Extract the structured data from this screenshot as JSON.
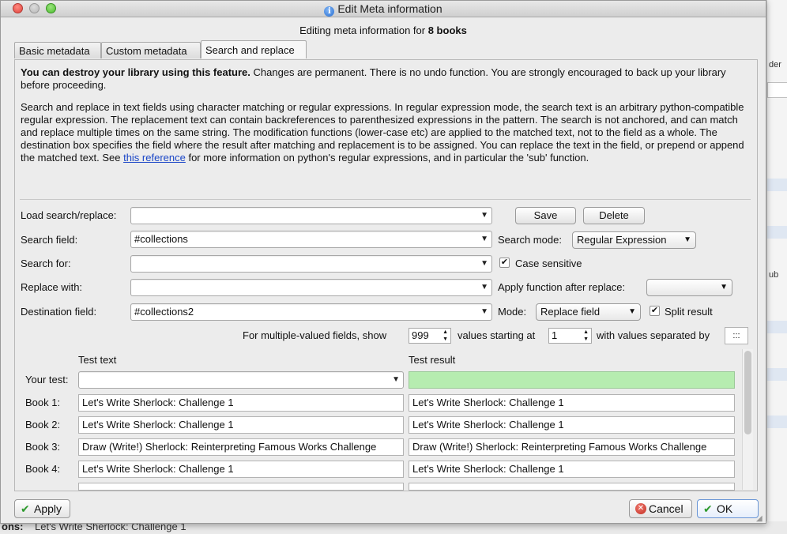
{
  "window": {
    "title": "Edit Meta information"
  },
  "heading": {
    "prefix": "Editing meta information for ",
    "count": "8 books"
  },
  "tabs": [
    {
      "label": "Basic metadata"
    },
    {
      "label": "Custom metadata"
    },
    {
      "label": "Search and replace"
    }
  ],
  "warning": {
    "bold": "You can destroy your library using this feature.",
    "rest": " Changes are permanent. There is no undo function. You are strongly encouraged to back up your library before proceeding."
  },
  "description": {
    "text": "Search and replace in text fields using character matching or regular expressions. In regular expression mode, the search text is an arbitrary python-compatible regular expression. The replacement text can contain backreferences to parenthesized expressions in the pattern. The search is not anchored, and can match and replace multiple times on the same string. The modification functions (lower-case etc) are applied to the matched text, not to the field as a whole. The destination box specifies the field where the result after matching and replacement is to be assigned. You can replace the text in the field, or prepend or append the matched text. See ",
    "link": "this reference",
    "tail": " for more information on python's regular expressions, and in particular the 'sub' function."
  },
  "form": {
    "load_label": "Load search/replace:",
    "load_value": "",
    "save_label": "Save",
    "delete_label": "Delete",
    "search_field_label": "Search field:",
    "search_field_value": "#collections",
    "search_mode_label": "Search mode:",
    "search_mode_value": "Regular Expression",
    "search_for_label": "Search for:",
    "search_for_value": "",
    "case_sensitive_label": "Case sensitive",
    "case_sensitive_checked": true,
    "replace_with_label": "Replace with:",
    "replace_with_value": "",
    "apply_function_label": "Apply function after replace:",
    "apply_function_value": "",
    "destination_label": "Destination field:",
    "destination_value": "#collections2",
    "mode_label": "Mode:",
    "mode_value": "Replace field",
    "split_result_label": "Split result",
    "split_result_checked": true,
    "multi_prefix": "For multiple-valued fields, show",
    "multi_show_value": "999",
    "multi_starting_label": "values starting at",
    "multi_start_value": "1",
    "multi_sep_label": "with values separated by",
    "multi_sep_value": ":::"
  },
  "test": {
    "test_text_header": "Test text",
    "test_result_header": "Test result",
    "your_test_label": "Your test:",
    "your_test_value": "",
    "your_result_value": "",
    "books": [
      {
        "label": "Book 1:",
        "text": "Let's Write Sherlock: Challenge 1",
        "result": "Let's Write Sherlock: Challenge 1"
      },
      {
        "label": "Book 2:",
        "text": "Let's Write Sherlock: Challenge 1",
        "result": "Let's Write Sherlock: Challenge 1"
      },
      {
        "label": "Book 3:",
        "text": "Draw (Write!) Sherlock: Reinterpreting Famous Works Challenge",
        "result": "Draw (Write!) Sherlock: Reinterpreting Famous Works Challenge"
      },
      {
        "label": "Book 4:",
        "text": "Let's Write Sherlock: Challenge 1",
        "result": "Let's Write Sherlock: Challenge 1"
      }
    ]
  },
  "buttons": {
    "apply": "Apply",
    "cancel": "Cancel",
    "ok": "OK"
  },
  "background": {
    "right_label_1": "der",
    "right_label_2": "ub",
    "bottom_label": "ons:",
    "bottom_value": "Let's Write Sherlock: Challenge 1"
  }
}
